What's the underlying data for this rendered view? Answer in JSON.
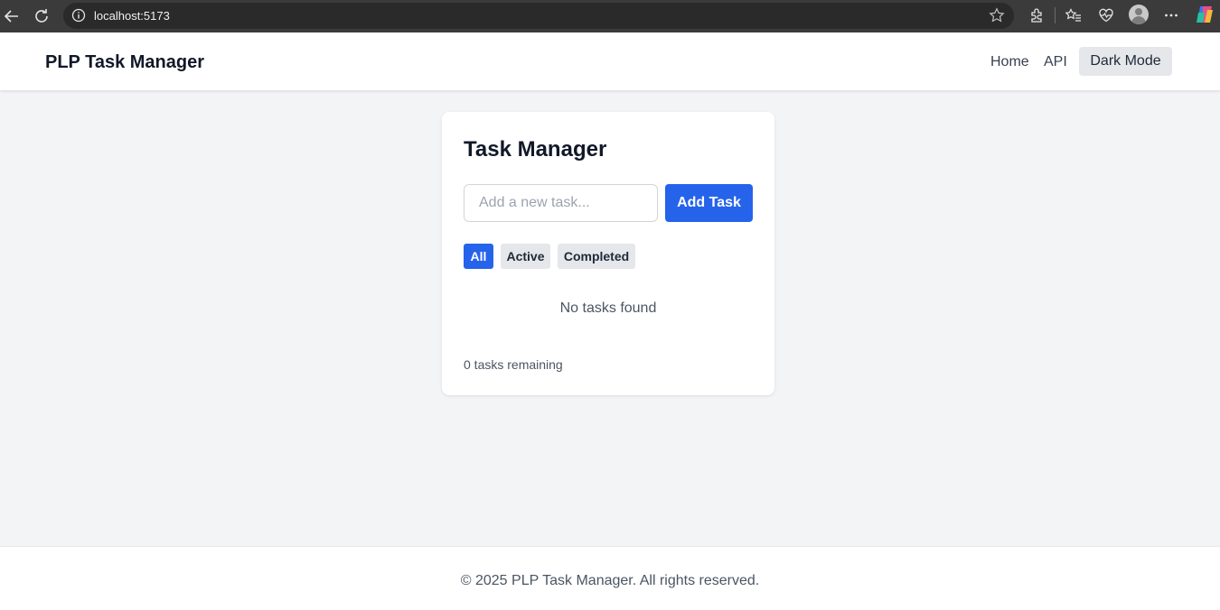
{
  "browser": {
    "url": "localhost:5173",
    "icons": [
      "back-arrow-icon",
      "reload-icon",
      "info-icon",
      "star-icon",
      "extensions-icon",
      "favorites-icon",
      "health-icon",
      "profile-avatar",
      "more-icon",
      "copilot-icon"
    ]
  },
  "header": {
    "brand": "PLP Task Manager",
    "nav": {
      "home": "Home",
      "api": "API",
      "dark_mode": "Dark Mode"
    }
  },
  "card": {
    "title": "Task Manager",
    "input": {
      "placeholder": "Add a new task...",
      "value": ""
    },
    "add_button": "Add Task",
    "filters": {
      "all": "All",
      "active": "Active",
      "completed": "Completed",
      "selected": "All"
    },
    "empty_message": "No tasks found",
    "remaining": "0 tasks remaining"
  },
  "footer": {
    "text": "© 2025 PLP Task Manager. All rights reserved."
  },
  "colors": {
    "accent": "#2563eb",
    "page_bg": "#f3f4f6",
    "chrome_bg": "#3b3b3b"
  }
}
